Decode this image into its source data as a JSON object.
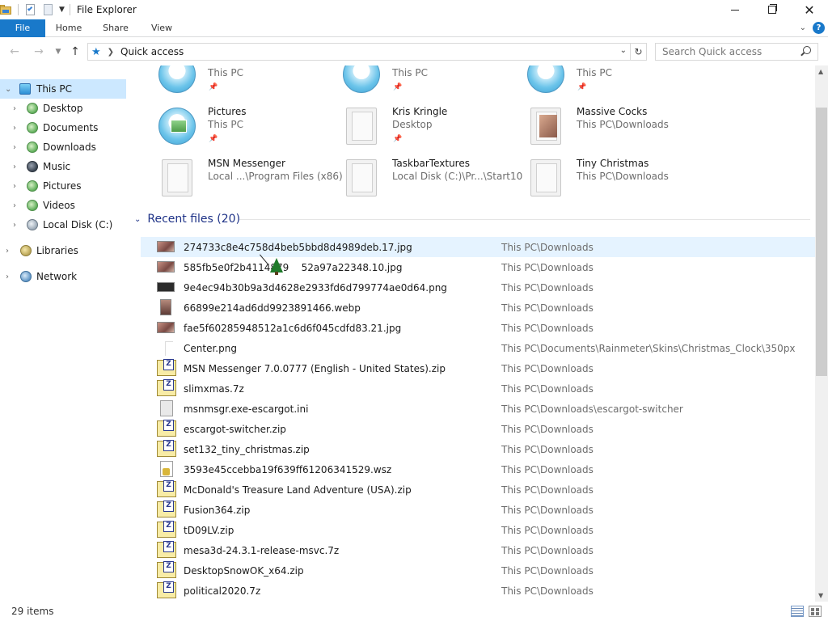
{
  "window": {
    "title": "File Explorer",
    "minimize_label": "—",
    "maximize_label": "",
    "close_label": "✕"
  },
  "ribbon": {
    "tabs": [
      "File",
      "Home",
      "Share",
      "View"
    ],
    "help_label": "?"
  },
  "addressbar": {
    "location": "Quick access",
    "search_placeholder": "Search Quick access",
    "refresh_glyph": "↻"
  },
  "nav": {
    "items": [
      {
        "label": "This PC",
        "icon": "computer-icon"
      },
      {
        "label": "Desktop",
        "icon": "desktop-icon"
      },
      {
        "label": "Documents",
        "icon": "documents-icon"
      },
      {
        "label": "Downloads",
        "icon": "downloads-icon"
      },
      {
        "label": "Music",
        "icon": "music-icon"
      },
      {
        "label": "Pictures",
        "icon": "pictures-icon"
      },
      {
        "label": "Videos",
        "icon": "videos-icon"
      },
      {
        "label": "Local Disk (C:)",
        "icon": "disk-icon"
      },
      {
        "label": "Libraries",
        "icon": "libraries-icon"
      },
      {
        "label": "Network",
        "icon": "network-icon"
      }
    ]
  },
  "quick_access": {
    "tiles": [
      {
        "name": "",
        "location": "This PC"
      },
      {
        "name": "",
        "location": "This PC"
      },
      {
        "name": "",
        "location": "This PC"
      },
      {
        "name": "Pictures",
        "location": "This PC"
      },
      {
        "name": "Kris Kringle",
        "location": "Desktop"
      },
      {
        "name": "Massive Cocks",
        "location": "This PC\\Downloads"
      },
      {
        "name": "MSN Messenger",
        "location": "Local ...\\Program Files (x86)"
      },
      {
        "name": "TaskbarTextures",
        "location": "Local Disk (C:)\\Pr...\\Start10"
      },
      {
        "name": "Tiny Christmas",
        "location": "This PC\\Downloads"
      }
    ]
  },
  "recent": {
    "heading": "Recent files (20)",
    "files": [
      {
        "name": "274733c8e4c758d4beb5bbd8d4989deb.17.jpg",
        "location": "This PC\\Downloads",
        "type": "image"
      },
      {
        "name": "585fb5e0f2b4114879    52a97a22348.10.jpg",
        "location": "This PC\\Downloads",
        "type": "image"
      },
      {
        "name": "9e4ec94b30b9a3d4628e2933fd6d799774ae0d64.png",
        "location": "This PC\\Downloads",
        "type": "dark"
      },
      {
        "name": "66899e214ad6dd9923891466.webp",
        "location": "This PC\\Downloads",
        "type": "tall"
      },
      {
        "name": "fae5f60285948512a1c6d6f045cdfd83.21.jpg",
        "location": "This PC\\Downloads",
        "type": "image"
      },
      {
        "name": "Center.png",
        "location": "This PC\\Documents\\Rainmeter\\Skins\\Christmas_Clock\\350px",
        "type": "blank"
      },
      {
        "name": "MSN Messenger 7.0.0777 (English - United States).zip",
        "location": "This PC\\Downloads",
        "type": "zip"
      },
      {
        "name": "slimxmas.7z",
        "location": "This PC\\Downloads",
        "type": "zip"
      },
      {
        "name": "msnmsgr.exe-escargot.ini",
        "location": "This PC\\Downloads\\escargot-switcher",
        "type": "ini"
      },
      {
        "name": "escargot-switcher.zip",
        "location": "This PC\\Downloads",
        "type": "zip"
      },
      {
        "name": "set132_tiny_christmas.zip",
        "location": "This PC\\Downloads",
        "type": "zip"
      },
      {
        "name": "3593e45ccebba19f639ff61206341529.wsz",
        "location": "This PC\\Downloads",
        "type": "wsz"
      },
      {
        "name": "McDonald's Treasure Land Adventure (USA).zip",
        "location": "This PC\\Downloads",
        "type": "zip"
      },
      {
        "name": "Fusion364.zip",
        "location": "This PC\\Downloads",
        "type": "zip"
      },
      {
        "name": "tD09LV.zip",
        "location": "This PC\\Downloads",
        "type": "zip"
      },
      {
        "name": "mesa3d-24.3.1-release-msvc.7z",
        "location": "This PC\\Downloads",
        "type": "zip"
      },
      {
        "name": "DesktopSnowOK_x64.zip",
        "location": "This PC\\Downloads",
        "type": "zip"
      },
      {
        "name": "political2020.7z",
        "location": "This PC\\Downloads",
        "type": "zip"
      }
    ]
  },
  "status": {
    "item_count": "29 items"
  }
}
